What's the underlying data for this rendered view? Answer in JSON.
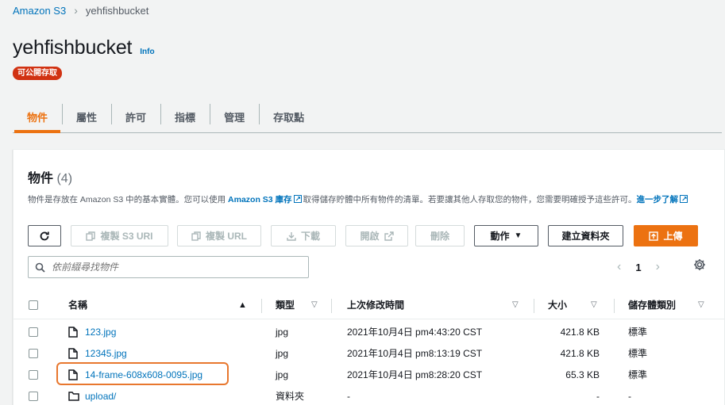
{
  "breadcrumb": {
    "root": "Amazon S3",
    "current": "yehfishbucket"
  },
  "header": {
    "title": "yehfishbucket",
    "info": "Info",
    "badge": "可公開存取"
  },
  "tabs": [
    "物件",
    "屬性",
    "許可",
    "指標",
    "管理",
    "存取點"
  ],
  "panel": {
    "title": "物件",
    "count": "(4)",
    "desc_part1": "物件是存放在 Amazon S3 中的基本實體。您可以使用 ",
    "desc_link": "Amazon S3 庫存",
    "desc_part2": "取得儲存貯體中所有物件的清單。若要讓其他人存取您的物件，您需要明確授予這些許可。",
    "desc_learn": "進一步了解"
  },
  "toolbar": {
    "copy_s3_uri": "複製 S3 URI",
    "copy_url": "複製 URL",
    "download": "下載",
    "open": "開啟",
    "delete": "刪除",
    "actions": "動作",
    "create_folder": "建立資料夾",
    "upload": "上傳"
  },
  "search": {
    "placeholder": "依前綴尋找物件"
  },
  "pagination": {
    "page": "1"
  },
  "columns": {
    "name": "名稱",
    "type": "類型",
    "modified": "上次修改時間",
    "size": "大小",
    "storage": "儲存體類別"
  },
  "rows": [
    {
      "name": "123.jpg",
      "type": "jpg",
      "modified": "2021年10月4日 pm4:43:20 CST",
      "size": "421.8 KB",
      "storage": "標準"
    },
    {
      "name": "12345.jpg",
      "type": "jpg",
      "modified": "2021年10月4日 pm8:13:19 CST",
      "size": "421.8 KB",
      "storage": "標準"
    },
    {
      "name": "14-frame-608x608-0095.jpg",
      "type": "jpg",
      "modified": "2021年10月4日 pm8:28:20 CST",
      "size": "65.3 KB",
      "storage": "標準"
    },
    {
      "name": "upload/",
      "type": "資料夾",
      "modified": "-",
      "size": "-",
      "storage": "-"
    }
  ],
  "colors": {
    "accent": "#ec7211",
    "link": "#0073bb",
    "badge": "#d13212",
    "highlight": "#e8772e"
  }
}
